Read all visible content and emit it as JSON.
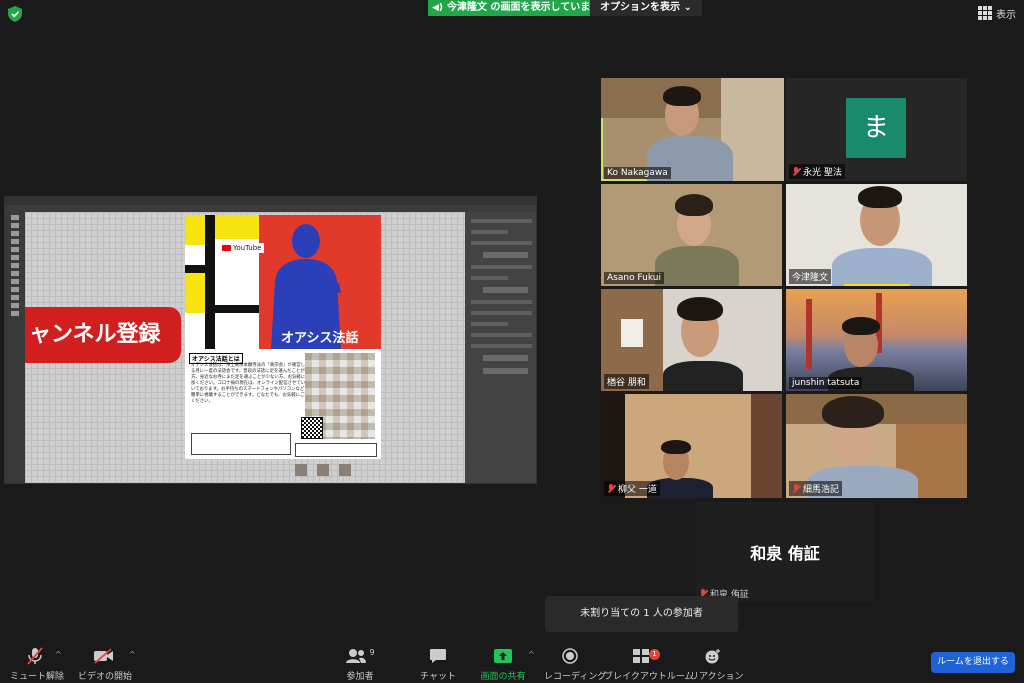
{
  "top": {
    "share_banner": "今津隆文 の画面を表示しています",
    "options": "オプションを表示",
    "view": "表示"
  },
  "shared_screen": {
    "register_button": "ャンネル登録",
    "poster": {
      "youtube_badge": "YouTube",
      "title": "オアシス法話",
      "about_heading": "オアシス法話とは",
      "body": "オアシス法話は、浄土真宗本願寺派の「真宗会」が運営している月に一度の法話会です。普段の法話に足を運んだことがない方、身近なお寺にまだ足を運ぶことが少ない方、お気軽にご参加ください。コロナ禍の現在は、オンライン配信させていただいております。お手持ちのスマートフォンやパソコンなどから簡単に視聴することができます。どなたでも、お気軽にご参加ください。"
    }
  },
  "participants": [
    {
      "name": "Ko Nakagawa",
      "muted": false,
      "active": true
    },
    {
      "name": "永光 聖法",
      "muted": true,
      "avatar": "ま"
    },
    {
      "name": "Asano Fukui",
      "muted": false
    },
    {
      "name": "今津隆文",
      "muted": false
    },
    {
      "name": "楢谷 朋和",
      "muted": false
    },
    {
      "name": "junshin tatsuta",
      "muted": false
    },
    {
      "name": "柳父 一道",
      "muted": true
    },
    {
      "name": "細馬浩記",
      "muted": true
    },
    {
      "name": "和泉 侑証",
      "muted": true,
      "label": "和泉 侑証"
    }
  ],
  "tooltip": "未割り当ての 1 人の参加者",
  "toolbar": {
    "mute": "ミュート解除",
    "video": "ビデオの開始",
    "participants": "参加者",
    "participants_count": "9",
    "chat": "チャット",
    "share": "画面の共有",
    "record": "レコーディング",
    "breakout": "ブレイクアウトルーム",
    "breakout_badge": "1",
    "reactions": "リアクション",
    "leave": "ルームを退出する"
  },
  "colors": {
    "share_green": "#23a54a",
    "leave_blue": "#1f63d6",
    "active_speaker": "#c9e36b",
    "muted_red": "#e0443e"
  }
}
